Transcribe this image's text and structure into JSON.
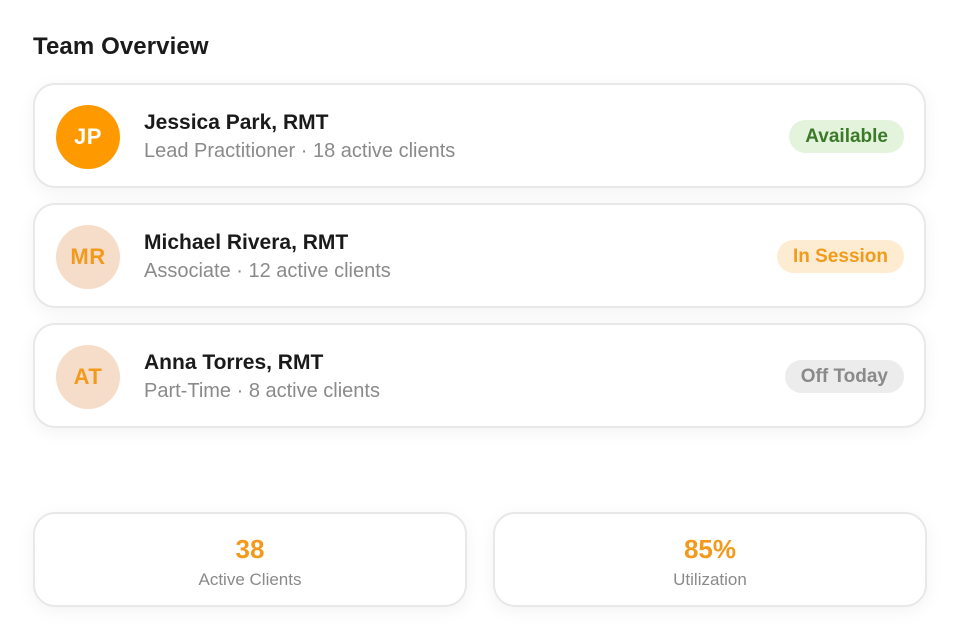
{
  "page": {
    "title": "Team Overview"
  },
  "team": [
    {
      "initials": "JP",
      "name": "Jessica Park, RMT",
      "meta": "Lead Practitioner · 18 active clients",
      "status": "Available",
      "status_color": "#3c7a2a"
    },
    {
      "initials": "MR",
      "name": "Michael Rivera, RMT",
      "meta": "Associate · 12 active clients",
      "status": "In Session",
      "status_color": "#f29b1b"
    },
    {
      "initials": "AT",
      "name": "Anna Torres, RMT",
      "meta": "Part-Time · 8 active clients",
      "status": "Off Today",
      "status_color": "#8a8a8a"
    }
  ],
  "stats": [
    {
      "value": "38",
      "label": "Active Clients"
    },
    {
      "value": "85%",
      "label": "Utilization"
    }
  ],
  "colors": {
    "accent": "#ff9900",
    "accent_soft": "#f6ddc9"
  }
}
